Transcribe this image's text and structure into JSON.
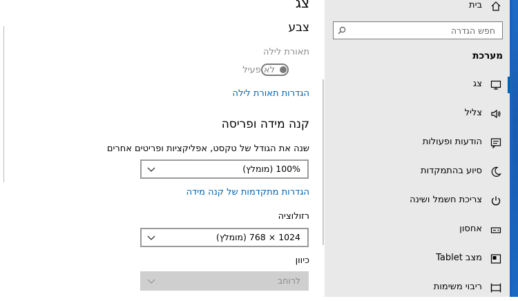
{
  "content": {
    "top_partial_heading": "צג",
    "color_heading": "צבע",
    "night_light_label": "תאורת לילה",
    "night_light_state": "לא פעיל",
    "night_light_settings_link": "הגדרות תאורת לילה",
    "scale_heading": "קנה מידה ופריסה",
    "scale_description": "שנה את הגודל של טקסט, אפליקציות ופריטים אחרים",
    "scale_value": "100% (מומלץ)",
    "advanced_scale_link": "הגדרות מתקדמות של קנה מידה",
    "resolution_label": "רזולוציה",
    "resolution_value": "1024 × 768 (מומלץ)",
    "orientation_label": "כיוון",
    "orientation_value": "לרוחב"
  },
  "sidebar": {
    "home_label": "בית",
    "search_placeholder": "חפש הגדרה",
    "section_title": "מערכת",
    "items": [
      {
        "label": "צג",
        "icon": "monitor-icon"
      },
      {
        "label": "צליל",
        "icon": "speaker-icon"
      },
      {
        "label": "הודעות ופעולות",
        "icon": "notification-icon"
      },
      {
        "label": "סיוע בהתמקדות",
        "icon": "moon-icon"
      },
      {
        "label": "צריכת חשמל ושינה",
        "icon": "power-icon"
      },
      {
        "label": "אחסון",
        "icon": "storage-icon"
      },
      {
        "label": "מצב Tablet",
        "icon": "tablet-icon"
      },
      {
        "label": "ריבוי משימות",
        "icon": "multitasking-icon"
      }
    ]
  },
  "colors": {
    "accent": "#0063b1",
    "sidebar_bg": "#e9e9e9"
  }
}
